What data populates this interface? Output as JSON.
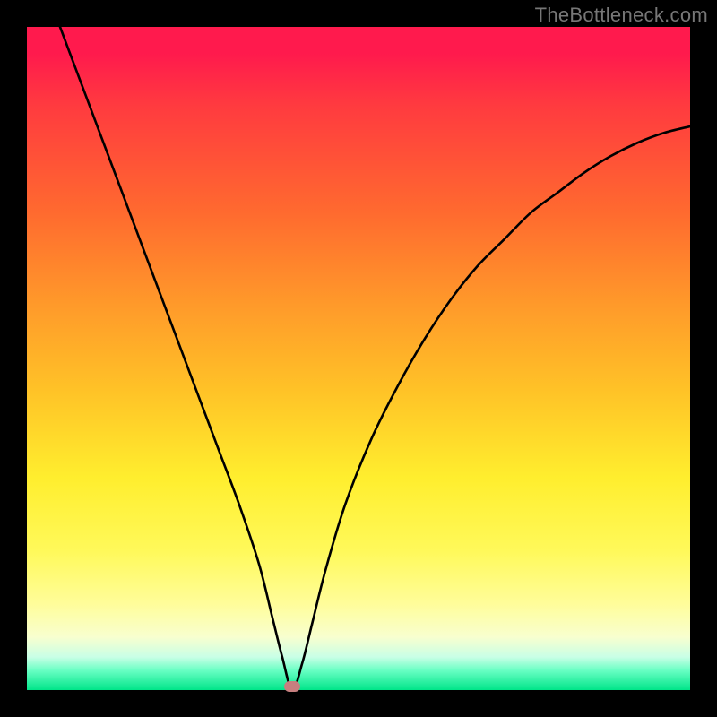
{
  "watermark": "TheBottleneck.com",
  "chart_data": {
    "type": "line",
    "title": "",
    "xlabel": "",
    "ylabel": "",
    "xlim": [
      0,
      100
    ],
    "ylim": [
      0,
      100
    ],
    "grid": false,
    "legend": false,
    "marker": {
      "x": 40,
      "y": 0
    },
    "series": [
      {
        "name": "bottleneck-curve",
        "x": [
          5,
          8,
          11,
          14,
          17,
          20,
          23,
          26,
          29,
          32,
          35,
          37,
          38.5,
          40,
          41.5,
          43,
          45,
          48,
          52,
          56,
          60,
          64,
          68,
          72,
          76,
          80,
          84,
          88,
          92,
          96,
          100
        ],
        "y": [
          100,
          92,
          84,
          76,
          68,
          60,
          52,
          44,
          36,
          28,
          19,
          11,
          5,
          0,
          4,
          10,
          18,
          28,
          38,
          46,
          53,
          59,
          64,
          68,
          72,
          75,
          78,
          80.5,
          82.5,
          84,
          85
        ]
      }
    ]
  },
  "colors": {
    "curve_stroke": "#000000",
    "marker_fill": "#c77f7f",
    "background_top": "#ff1a4d",
    "background_bottom": "#00e589",
    "frame": "#000000"
  }
}
